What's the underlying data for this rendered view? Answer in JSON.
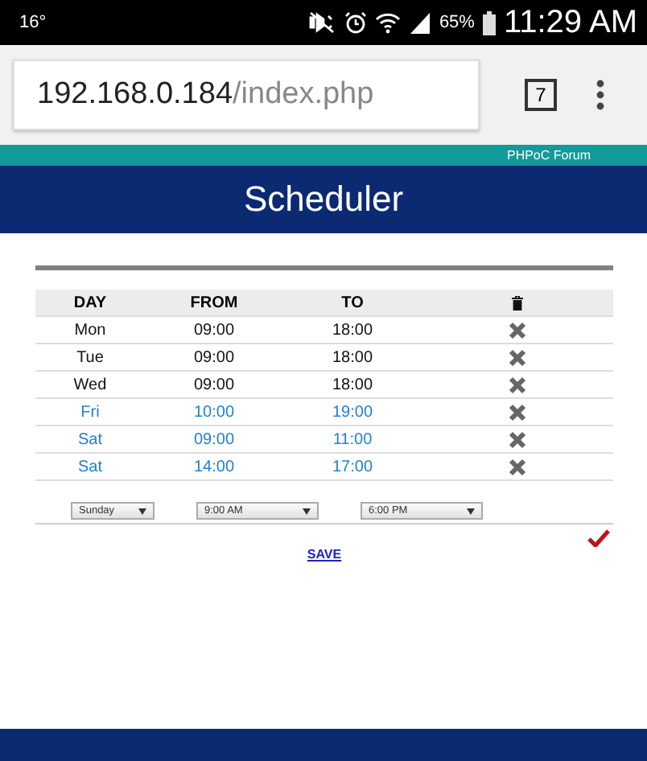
{
  "status_bar": {
    "temperature": "16°",
    "battery": "65%",
    "time": "11:29 AM"
  },
  "browser": {
    "url_host": "192.168.0.184",
    "url_path": "/index.php",
    "tab_count": "7"
  },
  "header": {
    "forum_link": "PHPoC Forum",
    "title": "Scheduler"
  },
  "table": {
    "columns": [
      "DAY",
      "FROM",
      "TO"
    ],
    "rows": [
      {
        "day": "Mon",
        "from": "09:00",
        "to": "18:00",
        "color": "#111111"
      },
      {
        "day": "Tue",
        "from": "09:00",
        "to": "18:00",
        "color": "#111111"
      },
      {
        "day": "Wed",
        "from": "09:00",
        "to": "18:00",
        "color": "#111111"
      },
      {
        "day": "Fri",
        "from": "10:00",
        "to": "19:00",
        "color": "#1e7fd6"
      },
      {
        "day": "Sat",
        "from": "09:00",
        "to": "11:00",
        "color": "#1e7fd6"
      },
      {
        "day": "Sat",
        "from": "14:00",
        "to": "17:00",
        "color": "#1e7fd6"
      }
    ]
  },
  "new_entry": {
    "day": "Sunday",
    "from": "9:00 AM",
    "to": "6:00 PM"
  },
  "save_link": "SAVE"
}
